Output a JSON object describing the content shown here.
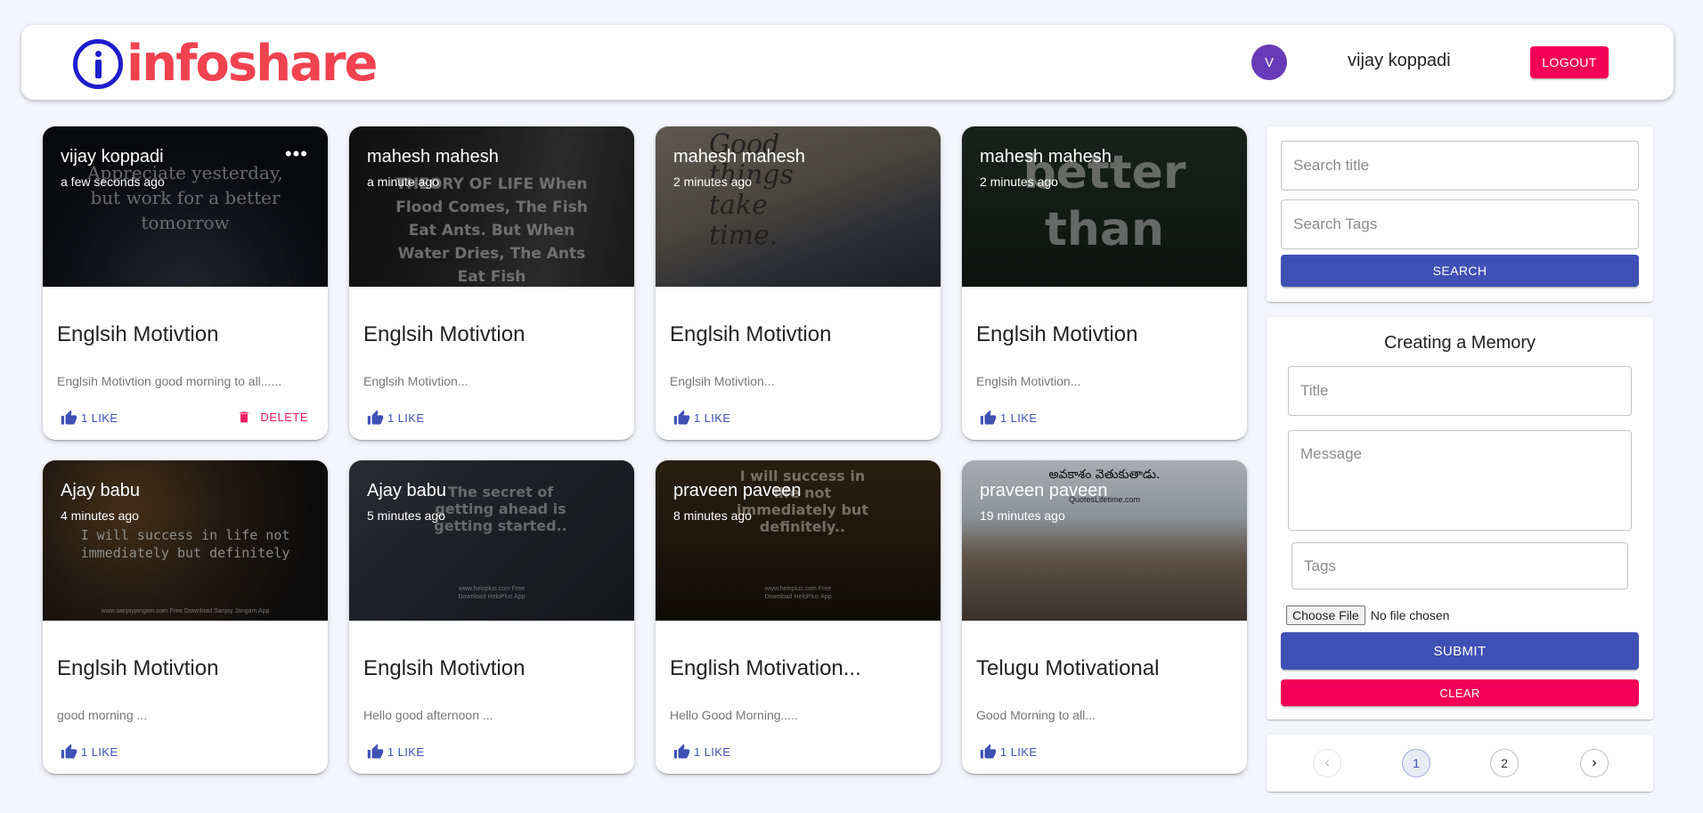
{
  "header": {
    "logo_text": "infoshare",
    "avatar_initial": "V",
    "username": "vijay koppadi",
    "logout_label": "LOGOUT"
  },
  "posts": [
    {
      "author": "vijay koppadi",
      "time": "a few seconds ago",
      "title": "Englsih Motivtion",
      "message": "Englsih Motivtion good morning to all......",
      "likes": "1 LIKE",
      "image_text": "Appreciate yesterday, but work for a better tomorrow",
      "has_delete": true,
      "delete_label": "DELETE"
    },
    {
      "author": "mahesh mahesh",
      "time": "a minute ago",
      "title": "Englsih Motivtion",
      "message": "Englsih Motivtion...",
      "likes": "1 LIKE",
      "image_text": "THEORY OF LIFE When Flood Comes, The Fish Eat Ants. But When Water Dries, The Ants Eat Fish"
    },
    {
      "author": "mahesh mahesh",
      "time": "2 minutes ago",
      "title": "Englsih Motivtion",
      "message": "Englsih Motivtion...",
      "likes": "1 LIKE",
      "image_text": "Good things take time."
    },
    {
      "author": "mahesh mahesh",
      "time": "2 minutes ago",
      "title": "Englsih Motivtion",
      "message": "Englsih Motivtion...",
      "likes": "1 LIKE",
      "image_text": "better than"
    },
    {
      "author": "Ajay babu",
      "time": "4 minutes ago",
      "title": "Englsih Motivtion",
      "message": "good morning ...",
      "likes": "1 LIKE",
      "image_text": "I will success in life not immediately but definitely",
      "image_footer": "www.sanjayjangam.com Free Download Sanjay Jangam App"
    },
    {
      "author": "Ajay babu",
      "time": "5 minutes ago",
      "title": "Englsih Motivtion",
      "message": "Hello good afternoon ...",
      "likes": "1 LIKE",
      "image_text": "The secret of getting ahead is getting started..",
      "image_footer": "www.heloplus.com Free Download HeloPlus App"
    },
    {
      "author": "praveen paveen",
      "time": "8 minutes ago",
      "title": "English Motivation...",
      "message": "Hello Good Morning.....",
      "likes": "1 LIKE",
      "image_text": "I will success in life not immediately but definitely..",
      "image_footer": "www.heloplus.com Free Download HeloPlus App"
    },
    {
      "author": "praveen paveen",
      "time": "19 minutes ago",
      "title": "Telugu Motivational",
      "message": "Good Morning to all...",
      "likes": "1 LIKE",
      "image_text": "అవకాశం వెతుకుతాడు.",
      "image_footer": "QuotesLifetime.com"
    }
  ],
  "search": {
    "title_placeholder": "Search title",
    "tags_placeholder": "Search Tags",
    "button_label": "SEARCH"
  },
  "form": {
    "heading": "Creating a Memory",
    "title_placeholder": "Title",
    "message_placeholder": "Message",
    "tags_placeholder": "Tags",
    "file_button": "Choose File",
    "file_status": "No file chosen",
    "submit_label": "SUBMIT",
    "clear_label": "CLEAR"
  },
  "pagination": {
    "pages": [
      "1",
      "2"
    ],
    "current": "1"
  },
  "colors": {
    "primary": "#3f51b5",
    "secondary": "#f50057",
    "avatar": "#673ab7",
    "logo_red": "#f14250",
    "logo_blue": "#1d1dcc"
  }
}
